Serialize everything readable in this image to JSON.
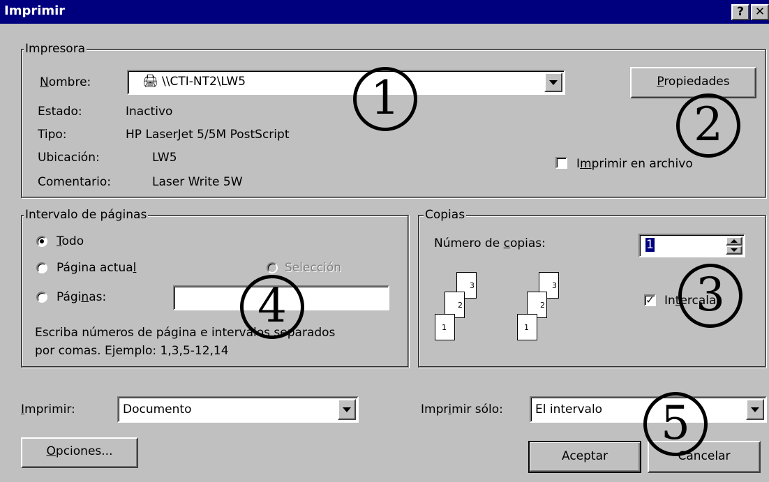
{
  "window": {
    "title": "Imprimir",
    "help_glyph": "?",
    "close_glyph": "✕"
  },
  "printer": {
    "legend": "Impresora",
    "name_label": "Nombre:",
    "name_value": "\\\\CTI-NT2\\LW5",
    "status_label": "Estado:",
    "status_value": "Inactivo",
    "type_label": "Tipo:",
    "type_value": "HP LaserJet 5/5M PostScript",
    "location_label": "Ubicación:",
    "location_value": "LW5",
    "comment_label": "Comentario:",
    "comment_value": "Laser Write 5W",
    "properties_button": "Propiedades",
    "print_to_file_label": "Imprimir en archivo",
    "print_to_file_checked": false
  },
  "page_range": {
    "legend": "Intervalo de páginas",
    "all_label": "Todo",
    "current_page_label": "Página actual",
    "selection_label": "Selección",
    "pages_label": "Páginas:",
    "pages_value": "",
    "hint_line1": "Escriba números de página e intervalos separados",
    "hint_line2": "por comas. Ejemplo: 1,3,5-12,14",
    "selected": "Todo"
  },
  "copies": {
    "legend": "Copias",
    "number_label": "Número de copias:",
    "number_value": "1",
    "collate_label": "Intercalar",
    "collate_checked": true,
    "stack_page_numbers": [
      "3",
      "2",
      "1"
    ]
  },
  "bottom": {
    "print_label": "Imprimir:",
    "print_value": "Documento",
    "print_only_label": "Imprimir sólo:",
    "print_only_value": "El intervalo",
    "options_button": "Opciones...",
    "ok_button": "Aceptar",
    "cancel_button": "Cancelar"
  },
  "annotations": [
    "①",
    "②",
    "③",
    "④",
    "⑤"
  ],
  "colors": {
    "titlebar": "#00007f",
    "face": "#c0c0c0",
    "annotation": "#000000"
  }
}
